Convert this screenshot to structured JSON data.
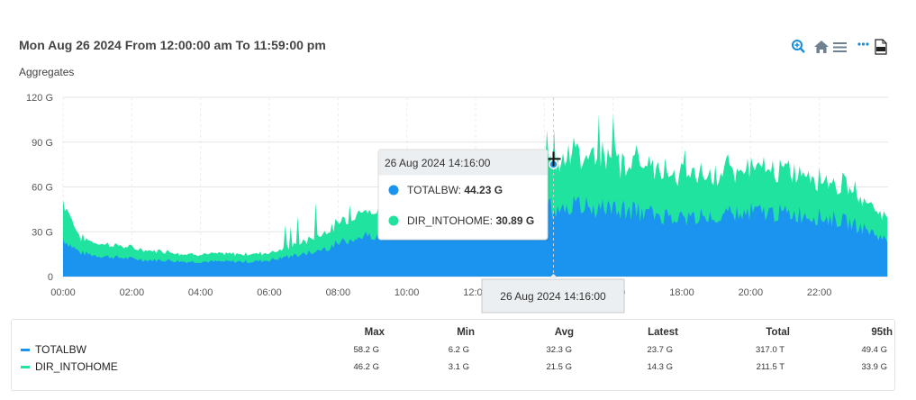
{
  "header": {
    "title": "Mon Aug 26 2024 From 12:00:00 am To 11:59:00 pm",
    "subtitle": "Aggregates"
  },
  "toolbar": {
    "icons": [
      "zoom-icon",
      "home-icon",
      "menu-icon",
      "more-icon",
      "pdf-icon"
    ]
  },
  "colors": {
    "TOTALBW": "#1a94ef",
    "DIR_INTOHOME": "#1fe39e",
    "grid": "#e6e6e6",
    "axis_text": "#555555"
  },
  "chart_data": {
    "type": "area",
    "title": "",
    "xlabel": "",
    "ylabel": "",
    "ylim": [
      0,
      120
    ],
    "y_unit": "G",
    "y_ticks": [
      "0",
      "30 G",
      "60 G",
      "90 G",
      "120 G"
    ],
    "x_ticks": [
      "00:00",
      "02:00",
      "04:00",
      "06:00",
      "08:00",
      "10:00",
      "12:00",
      "14:00",
      "16:00",
      "18:00",
      "20:00",
      "22:00"
    ],
    "grid": true,
    "stacked": true,
    "x_hours": [
      0,
      0.5,
      1,
      1.5,
      2,
      2.5,
      3,
      3.5,
      4,
      4.5,
      5,
      5.5,
      6,
      6.5,
      7,
      7.5,
      8,
      8.5,
      9,
      9.5,
      10,
      10.5,
      11,
      11.5,
      12,
      12.5,
      13,
      13.5,
      14,
      14.5,
      15,
      15.5,
      16,
      16.5,
      17,
      17.5,
      18,
      18.5,
      19,
      19.5,
      20,
      20.5,
      21,
      21.5,
      22,
      22.5,
      23,
      23.5,
      23.98
    ],
    "series": [
      {
        "name": "TOTALBW",
        "values": [
          25,
          16,
          14,
          13,
          12,
          11,
          11,
          10,
          10,
          10,
          10,
          10,
          11,
          13,
          15,
          18,
          22,
          26,
          28,
          31,
          32,
          34,
          35,
          36,
          38,
          38,
          40,
          43,
          45,
          46,
          47,
          46,
          45,
          44,
          42,
          41,
          40,
          40,
          41,
          42,
          43,
          43,
          42,
          42,
          40,
          38,
          35,
          30,
          24
        ]
      },
      {
        "name": "DIR_INTOHOME",
        "values": [
          25,
          10,
          8,
          8,
          7,
          6,
          6,
          5,
          5,
          5,
          5,
          5,
          5,
          6,
          8,
          10,
          13,
          15,
          17,
          18,
          20,
          21,
          22,
          22,
          23,
          25,
          28,
          30,
          31,
          32,
          33,
          33,
          32,
          31,
          30,
          29,
          28,
          27,
          27,
          28,
          28,
          28,
          27,
          27,
          26,
          24,
          22,
          18,
          14
        ]
      }
    ],
    "tooltip": {
      "time": "26 Aug 2024 14:16:00",
      "entries": [
        {
          "name": "TOTALBW",
          "value": "44.23 G"
        },
        {
          "name": "DIR_INTOHOME",
          "value": "30.89 G"
        }
      ],
      "x_label": "26 Aug 2024 14:16:00"
    }
  },
  "legend": {
    "columns": [
      "Max",
      "Min",
      "Avg",
      "Latest",
      "Total",
      "95th"
    ],
    "rows": [
      {
        "name": "TOTALBW",
        "values": [
          "58.2 G",
          "6.2 G",
          "32.3 G",
          "23.7 G",
          "317.0 T",
          "49.4 G"
        ]
      },
      {
        "name": "DIR_INTOHOME",
        "values": [
          "46.2 G",
          "3.1 G",
          "21.5 G",
          "14.3 G",
          "211.5 T",
          "33.9 G"
        ]
      }
    ]
  }
}
